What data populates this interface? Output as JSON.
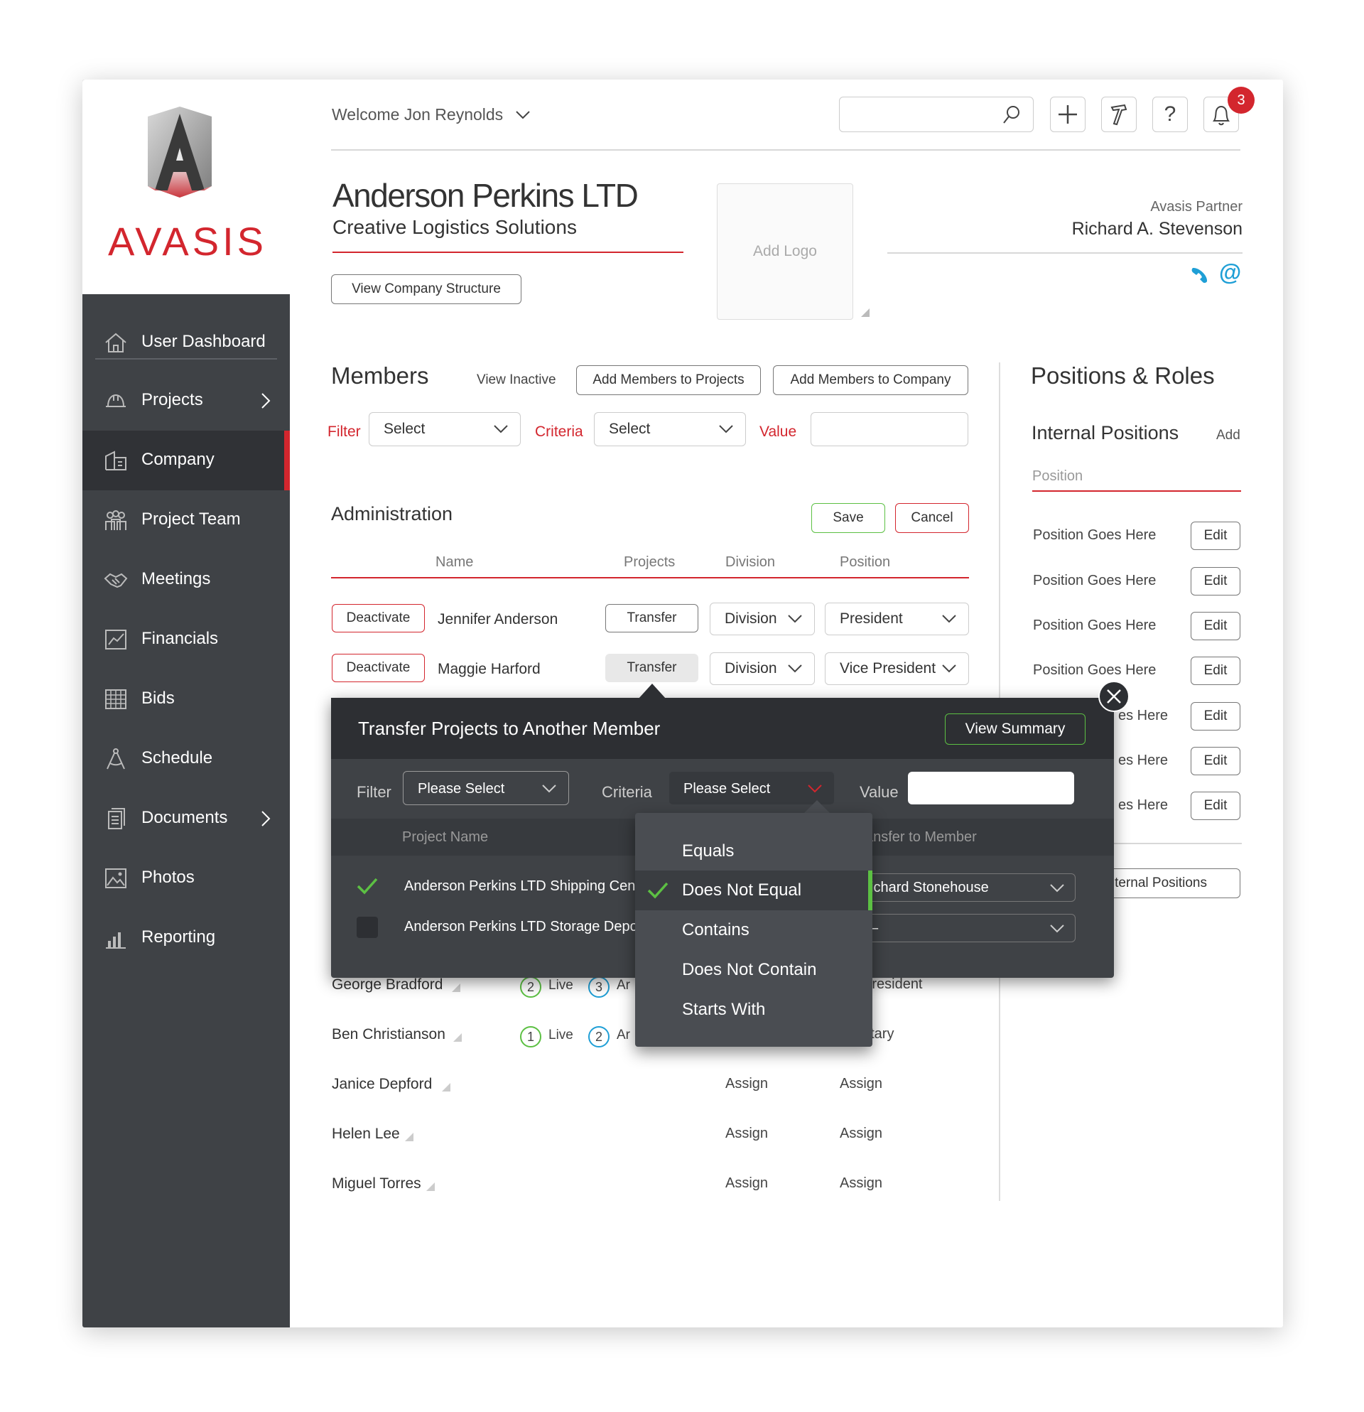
{
  "header": {
    "welcome": "Welcome Jon Reynolds",
    "notification_count": "3"
  },
  "brand": {
    "name": "AVASIS",
    "red": "#d3262e",
    "green": "#5cc043",
    "blue": "#1f9fd6"
  },
  "sidebar": {
    "items": [
      {
        "label": "User Dashboard",
        "icon": "house-icon"
      },
      {
        "label": "Projects",
        "icon": "hardhat-icon"
      },
      {
        "label": "Company",
        "icon": "company-icon"
      },
      {
        "label": "Project Team",
        "icon": "team-icon"
      },
      {
        "label": "Meetings",
        "icon": "handshake-icon"
      },
      {
        "label": "Financials",
        "icon": "chart-icon"
      },
      {
        "label": "Bids",
        "icon": "grid-icon"
      },
      {
        "label": "Schedule",
        "icon": "compass-icon"
      },
      {
        "label": "Documents",
        "icon": "document-icon"
      },
      {
        "label": "Photos",
        "icon": "photo-icon"
      },
      {
        "label": "Reporting",
        "icon": "bar-chart-icon"
      }
    ]
  },
  "company": {
    "name": "Anderson Perkins LTD",
    "tagline": "Creative Logistics Solutions",
    "view_structure": "View Company Structure",
    "add_logo": "Add Logo"
  },
  "partner": {
    "label": "Avasis Partner",
    "name": "Richard A. Stevenson"
  },
  "members": {
    "title": "Members",
    "view_inactive": "View Inactive",
    "add_projects": "Add Members to Projects",
    "add_company": "Add Members to Company",
    "filter_label": "Filter",
    "filter_value": "Select",
    "criteria_label": "Criteria",
    "criteria_value": "Select",
    "value_label": "Value"
  },
  "admin": {
    "title": "Administration",
    "save": "Save",
    "cancel": "Cancel",
    "cols": {
      "name": "Name",
      "projects": "Projects",
      "division": "Division",
      "position": "Position"
    },
    "rows": [
      {
        "action": "Deactivate",
        "name": "Jennifer Anderson",
        "transfer": "Transfer",
        "division": "Division",
        "position": "President"
      },
      {
        "action": "Deactivate",
        "name": "Maggie Harford",
        "transfer": "Transfer",
        "division": "Division",
        "position": "Vice President"
      }
    ]
  },
  "members_list": [
    {
      "name": "George Bradford",
      "live_n": "2",
      "live": "Live",
      "ar_n": "3",
      "ar": "Ar",
      "pos": "President"
    },
    {
      "name": "Ben Christianson",
      "live_n": "1",
      "live": "Live",
      "ar_n": "2",
      "ar": "Ar",
      "pos": "etary"
    },
    {
      "name": "Janice Depford",
      "division": "Assign",
      "position": "Assign"
    },
    {
      "name": "Helen Lee",
      "division": "Assign",
      "position": "Assign"
    },
    {
      "name": "Miguel Torres",
      "division": "Assign",
      "position": "Assign"
    }
  ],
  "positions": {
    "title": "Positions & Roles",
    "internal": "Internal Positions",
    "add": "Add",
    "col": "Position",
    "items": [
      "Position Goes Here",
      "Position Goes Here",
      "Position Goes Here",
      "Position Goes Here",
      "es Here",
      "es Here",
      "es Here"
    ],
    "edit": "Edit",
    "bottom_button": "ternal Positions"
  },
  "modal": {
    "title": "Transfer Projects to Another Member",
    "view_summary": "View Summary",
    "filter_label": "Filter",
    "filter_value": "Please Select",
    "criteria_label": "Criteria",
    "criteria_value": "Please Select",
    "value_label": "Value",
    "col_project": "Project Name",
    "col_transfer": "ansfer to Member",
    "rows": [
      {
        "project": "Anderson Perkins LTD Shipping Cen",
        "member": "ichard Stonehouse",
        "checked": true
      },
      {
        "project": "Anderson Perkins LTD Storage Depo",
        "member": "–",
        "checked": false
      }
    ]
  },
  "criteria_dropdown": {
    "options": [
      "Equals",
      "Does Not Equal",
      "Contains",
      "Does Not Contain",
      "Starts With"
    ],
    "selected": "Does Not Equal"
  }
}
